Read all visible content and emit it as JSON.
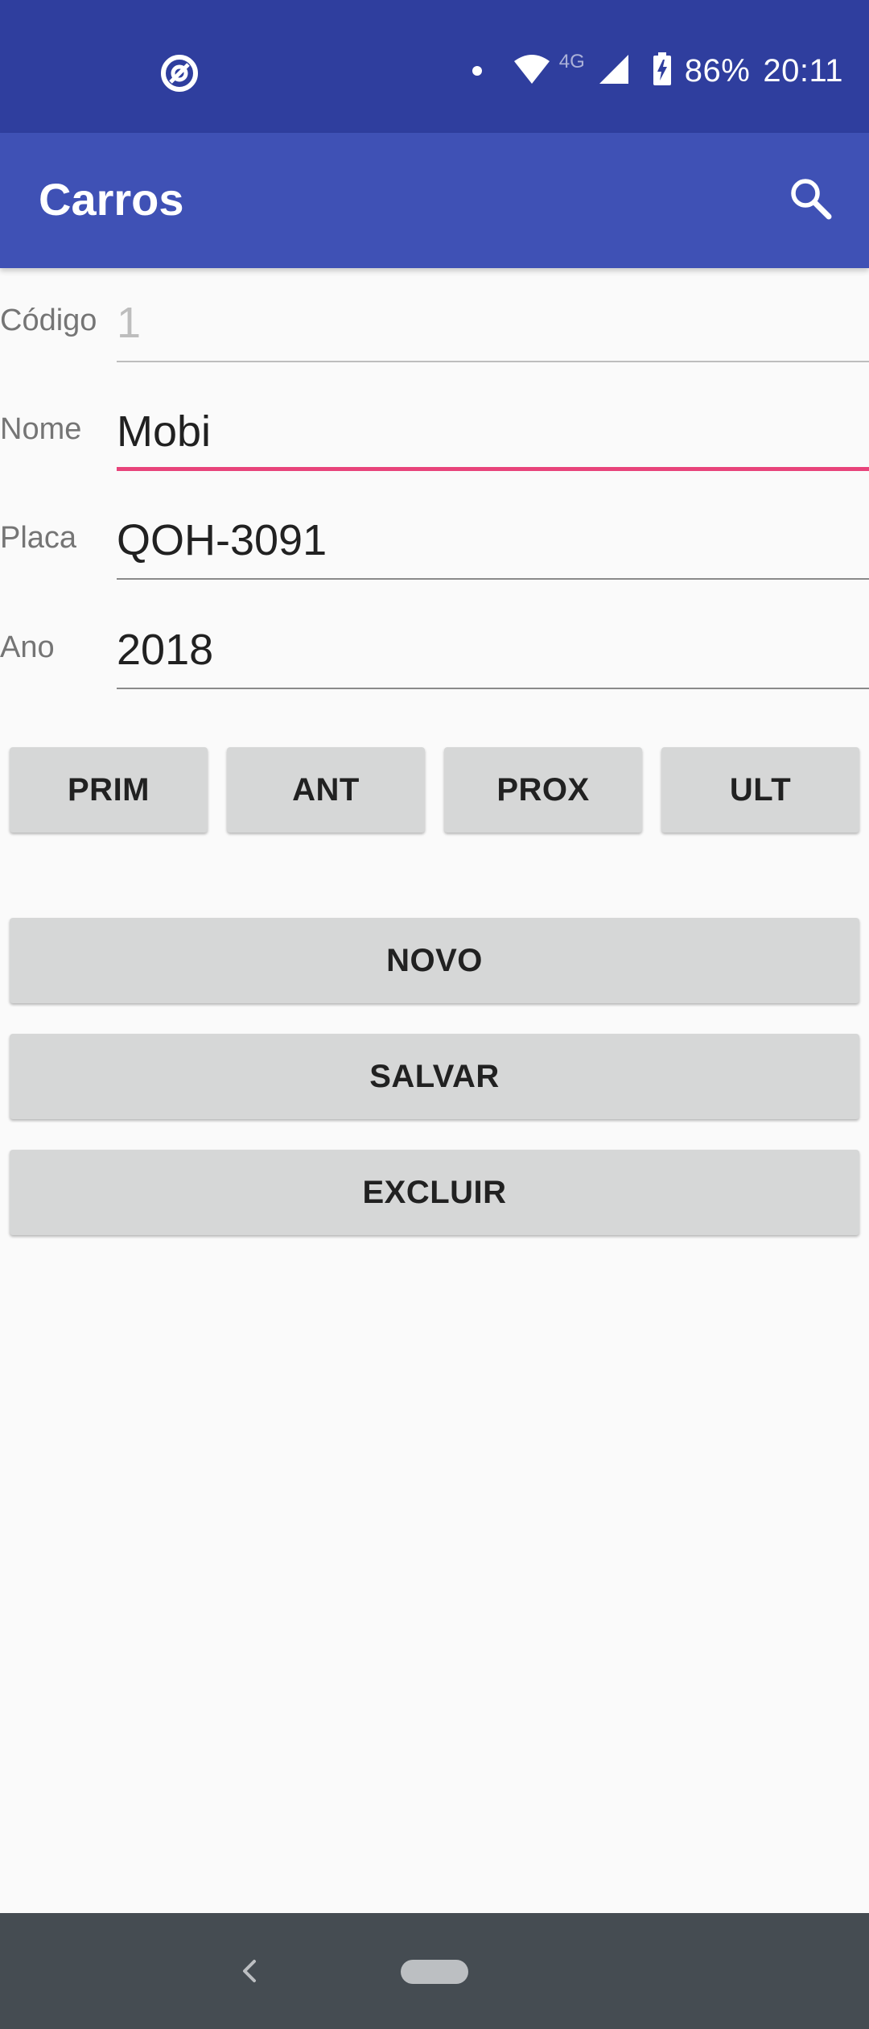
{
  "status_bar": {
    "battery": "86%",
    "time": "20:11",
    "network": "4G",
    "icons": [
      "vpn-icon",
      "notification-dot-icon",
      "wifi-icon",
      "signal-icon",
      "battery-charging-icon"
    ]
  },
  "app_bar": {
    "title": "Carros",
    "search_icon": "search-icon"
  },
  "form": {
    "codigo": {
      "label": "Código",
      "value": "1",
      "enabled": false
    },
    "nome": {
      "label": "Nome",
      "value": "Mobi",
      "focused": true
    },
    "placa": {
      "label": "Placa",
      "value": "QOH-3091"
    },
    "ano": {
      "label": "Ano",
      "value": "2018"
    }
  },
  "nav_buttons": {
    "prim": "PRIM",
    "ant": "ANT",
    "prox": "PROX",
    "ult": "ULT"
  },
  "actions": {
    "novo": "NOVO",
    "salvar": "SALVAR",
    "excluir": "EXCLUIR"
  },
  "colors": {
    "status_bar": "#2f3e9e",
    "app_bar": "#3f51b5",
    "accent": "#e8437a",
    "button": "#d6d7d7",
    "nav_bar": "#454c52"
  }
}
